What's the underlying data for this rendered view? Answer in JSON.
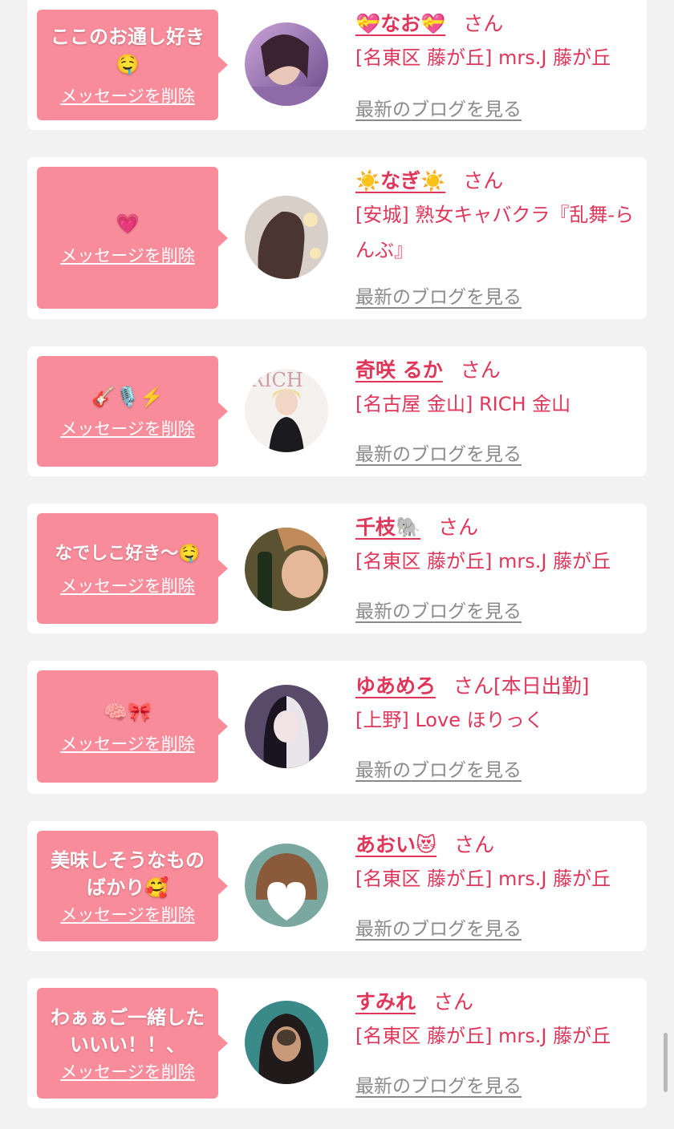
{
  "cards": [
    {
      "message": "ここのお通し好き🤤",
      "delete_label": "メッセージを削除",
      "name": "💝なお💝",
      "honorific": "さん",
      "shop": "[名東区 藤が丘] mrs.J 藤が丘",
      "blog_label": "最新のブログを見る"
    },
    {
      "message": "💗",
      "delete_label": "メッセージを削除",
      "name": "☀️なぎ☀️",
      "honorific": "さん",
      "shop": "[安城] 熟女キャバクラ『乱舞-らんぶ』",
      "blog_label": "最新のブログを見る"
    },
    {
      "message": "🎸🎙️⚡️",
      "delete_label": "メッセージを削除",
      "name": "奇咲 るか",
      "honorific": "さん",
      "shop": "[名古屋 金山] RICH 金山",
      "blog_label": "最新のブログを見る"
    },
    {
      "message": "なでしこ好き〜🤤",
      "delete_label": "メッセージを削除",
      "name": "千枝🐘",
      "honorific": "さん",
      "shop": "[名東区 藤が丘] mrs.J 藤が丘",
      "blog_label": "最新のブログを見る"
    },
    {
      "message": "🧠🎀",
      "delete_label": "メッセージを削除",
      "name": "ゆあめろ",
      "honorific": "さん[本日出勤]",
      "shop": "[上野] Love ほりっく",
      "blog_label": "最新のブログを見る"
    },
    {
      "message": "美味しそうなものばかり🥰",
      "delete_label": "メッセージを削除",
      "name": "あおい😻",
      "honorific": "さん",
      "shop": "[名東区 藤が丘] mrs.J 藤が丘",
      "blog_label": "最新のブログを見る"
    },
    {
      "message": "わぁぁご一緒したいいい！！、",
      "delete_label": "メッセージを削除",
      "name": "すみれ",
      "honorific": "さん",
      "shop": "[名東区 藤が丘] mrs.J 藤が丘",
      "blog_label": "最新のブログを見る"
    }
  ],
  "colors": {
    "background": "#f2f2f2",
    "bubble": "#f98c9b",
    "name_accent": "#e0365a",
    "link_gray": "#8a8a8a"
  }
}
